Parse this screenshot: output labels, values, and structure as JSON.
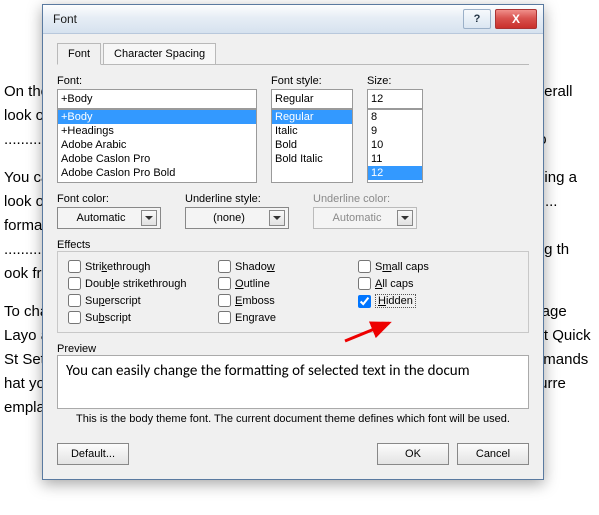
{
  "bg_paragraphs": [
    "On the ........................................................................................................... the overall look of ........................................................................... s, lists, co pages, ................................................................................................. diagrams, th also co",
    "You ca ................................................................................................................. osing a look or the ................................................................................................................... format text directl ................................................................................................................... e of using th ook fr",
    "To cha ............................................................................................................... e Page Layo ab. To ......................................................................................................... ent Quick St Set co .......................................................................................................... commands hat yo ....................................................................................................... in your curre empla"
  ],
  "title": "Font",
  "tabs": {
    "font": "Font",
    "spacing": "Character Spacing"
  },
  "font_section": {
    "label": "Font:",
    "value": "+Body",
    "options": [
      "+Body",
      "+Headings",
      "Adobe Arabic",
      "Adobe Caslon Pro",
      "Adobe Caslon Pro Bold"
    ],
    "selected": "+Body"
  },
  "style_section": {
    "label": "Font style:",
    "value": "Regular",
    "options": [
      "Regular",
      "Italic",
      "Bold",
      "Bold Italic"
    ],
    "selected": "Regular"
  },
  "size_section": {
    "label": "Size:",
    "value": "12",
    "options": [
      "8",
      "9",
      "10",
      "11",
      "12"
    ],
    "selected": "12"
  },
  "font_color": {
    "label": "Font color:",
    "value": "Automatic"
  },
  "underline_style": {
    "label": "Underline style:",
    "value": "(none)"
  },
  "underline_color": {
    "label": "Underline color:",
    "value": "Automatic"
  },
  "effects_label": "Effects",
  "effects": {
    "strikethrough": "Strikethrough",
    "dbl_strike": "Double strikethrough",
    "superscript": "Superscript",
    "subscript": "Subscript",
    "shadow": "Shadow",
    "outline": "Outline",
    "emboss": "Emboss",
    "engrave": "Engrave",
    "smallcaps": "Small caps",
    "allcaps": "All caps",
    "hidden": "Hidden"
  },
  "preview_label": "Preview",
  "preview_text": "You can easily change the formatting of selected text in the docum",
  "preview_note": "This is the body theme font. The current document theme defines which font will be used.",
  "buttons": {
    "default": "Default...",
    "ok": "OK",
    "cancel": "Cancel"
  }
}
